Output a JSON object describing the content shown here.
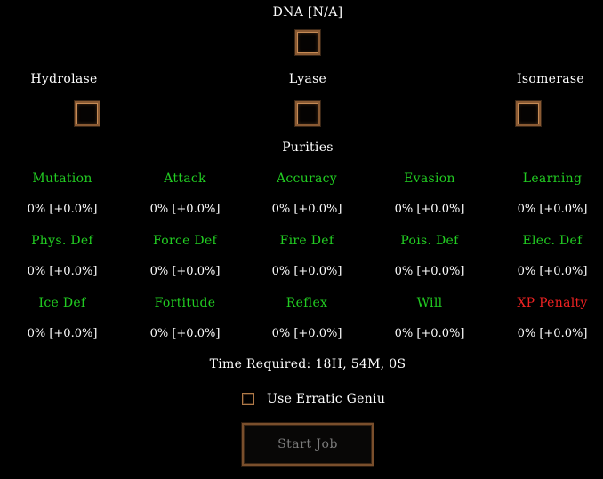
{
  "dna": {
    "label": "DNA [N/A]"
  },
  "enzymes": [
    {
      "key": "hydrolase",
      "label": "Hydrolase"
    },
    {
      "key": "lyase",
      "label": "Lyase"
    },
    {
      "key": "isomerase",
      "label": "Isomerase"
    }
  ],
  "purities_heading": "Purities",
  "stats": [
    [
      {
        "name": "Mutation",
        "value": "0%  [+0.0%]",
        "color": "#22cc22"
      },
      {
        "name": "Attack",
        "value": "0%  [+0.0%]",
        "color": "#22cc22"
      },
      {
        "name": "Accuracy",
        "value": "0%  [+0.0%]",
        "color": "#22cc22"
      },
      {
        "name": "Evasion",
        "value": "0%  [+0.0%]",
        "color": "#22cc22"
      },
      {
        "name": "Learning",
        "value": "0%  [+0.0%]",
        "color": "#22cc22"
      }
    ],
    [
      {
        "name": "Phys. Def",
        "value": "0%  [+0.0%]",
        "color": "#22cc22"
      },
      {
        "name": "Force Def",
        "value": "0%  [+0.0%]",
        "color": "#22cc22"
      },
      {
        "name": "Fire Def",
        "value": "0%  [+0.0%]",
        "color": "#22cc22"
      },
      {
        "name": "Pois. Def",
        "value": "0%  [+0.0%]",
        "color": "#22cc22"
      },
      {
        "name": "Elec. Def",
        "value": "0%  [+0.0%]",
        "color": "#22cc22"
      }
    ],
    [
      {
        "name": "Ice Def",
        "value": "0%  [+0.0%]",
        "color": "#22cc22"
      },
      {
        "name": "Fortitude",
        "value": "0%  [+0.0%]",
        "color": "#22cc22"
      },
      {
        "name": "Reflex",
        "value": "0%  [+0.0%]",
        "color": "#22cc22"
      },
      {
        "name": "Will",
        "value": "0%  [+0.0%]",
        "color": "#22cc22"
      },
      {
        "name": "XP Penalty",
        "value": "0%  [+0.0%]",
        "color": "#ee2222"
      }
    ]
  ],
  "time_required": "Time Required: 18H, 54M, 0S",
  "erratic_genius": {
    "label": "Use Erratic Geniu",
    "checked": false
  },
  "start_button": {
    "label": "Start Job",
    "enabled": false
  },
  "colors": {
    "stat_good": "#22cc22",
    "stat_bad": "#ee2222",
    "slot_border": "#8a5a33",
    "disabled_text": "#7b7b7b"
  }
}
